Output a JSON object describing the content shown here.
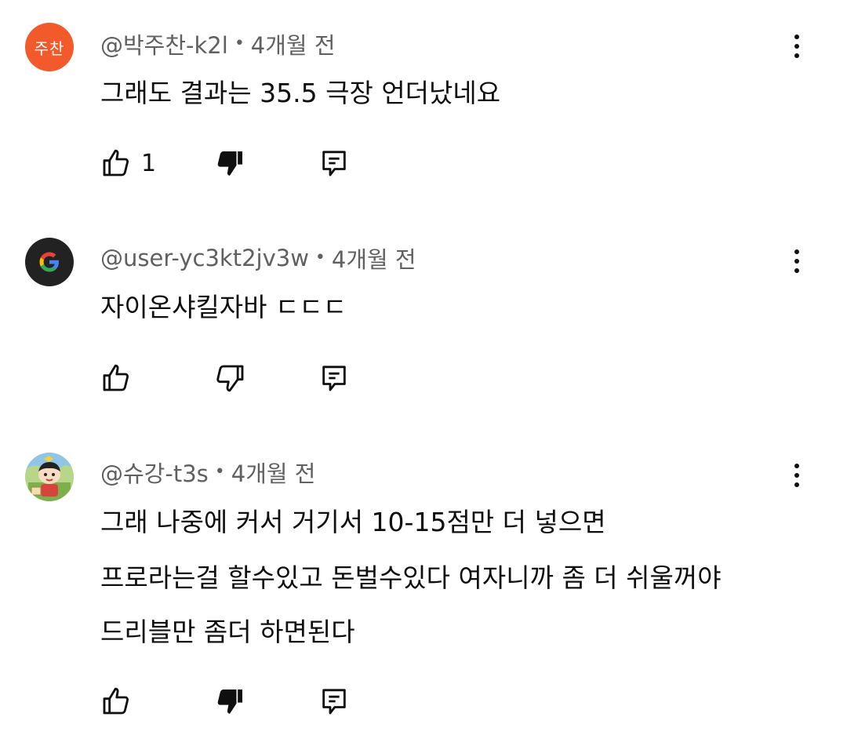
{
  "comments": [
    {
      "avatar_text": "주찬",
      "avatar_color": "#f25a2c",
      "author": "@박주찬-k2l",
      "time": "4개월 전",
      "lines": [
        "그래도 결과는 35.5 극장 언더났네요"
      ],
      "likes": "1",
      "disliked": true,
      "avatar_icon": "orange-initials-avatar"
    },
    {
      "avatar_text": "",
      "avatar_color": "#222222",
      "author": "@user-yc3kt2jv3w",
      "time": "4개월 전",
      "lines": [
        "자이온샤킬자바 ㄷㄷㄷ"
      ],
      "likes": "",
      "disliked": false,
      "avatar_icon": "google-g-avatar"
    },
    {
      "avatar_text": "",
      "avatar_color": "#8fbf6a",
      "author": "@슈강-t3s",
      "time": "4개월 전",
      "lines": [
        "그래 나중에 커서 거기서 10-15점만 더 넣으면",
        "프로라는걸 할수있고 돈벌수있다 여자니까 좀 더 쉬울꺼야",
        "드리블만 좀더 하면된다"
      ],
      "likes": "",
      "disliked": true,
      "avatar_icon": "cartoon-character-avatar"
    }
  ],
  "icons": {
    "like": "thumbs-up-icon",
    "dislike": "thumbs-down-icon",
    "reply": "reply-icon",
    "menu": "more-vertical-icon"
  },
  "separator": "•"
}
